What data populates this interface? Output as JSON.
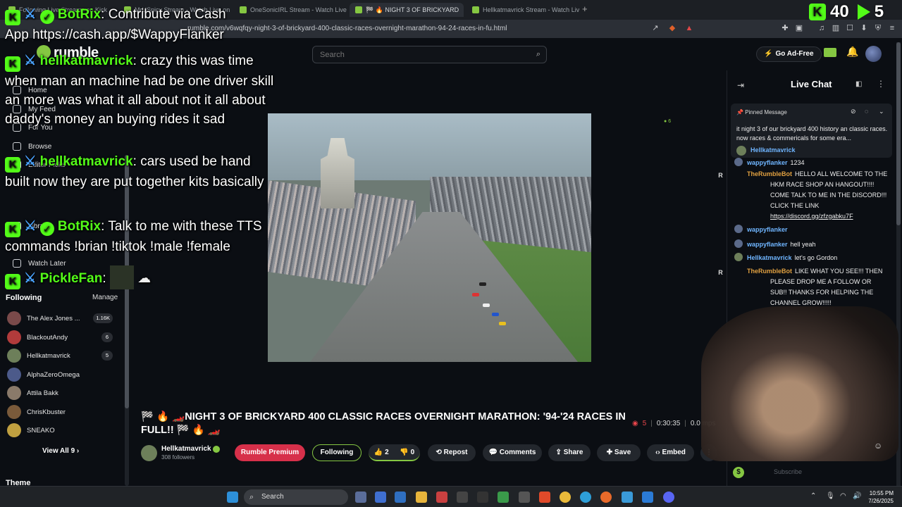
{
  "browser": {
    "tabs": [
      {
        "label": "Following Live Streams on Kick",
        "active": false
      },
      {
        "label": "MrUSpicy Stream - Watch Live on",
        "active": false
      },
      {
        "label": "OneSonicIRL Stream - Watch Live on",
        "active": false
      },
      {
        "label": "🏁 🔥 NIGHT 3 OF BRICKYARD",
        "active": true
      },
      {
        "label": "Hellkatmavrick Stream - Watch Live o",
        "active": false
      }
    ],
    "new_tab": "+",
    "url": "rumble.com/v6wqfqy-night-3-of-brickyard-400-classic-races-overnight-marathon-94-24-races-in-fu.html"
  },
  "header": {
    "logo": "rumble",
    "search_placeholder": "Search",
    "go_ad_free": "Go Ad-Free"
  },
  "sidebar": {
    "nav": [
      {
        "label": "Home"
      },
      {
        "label": "My Feed"
      },
      {
        "label": "For You"
      },
      {
        "label": "Browse"
      },
      {
        "label": "Editor Picks"
      },
      {
        "label": "Library"
      },
      {
        "label": "Watch Later"
      }
    ],
    "following_title": "Following",
    "manage": "Manage",
    "following": [
      {
        "name": "The Alex Jones ...",
        "badge": "1.16K",
        "color": "#7a4a4a"
      },
      {
        "name": "BlackoutAndy",
        "badge": "6",
        "color": "#b23b3b"
      },
      {
        "name": "Hellkatmavrick",
        "badge": "5",
        "color": "#6d7f5a"
      },
      {
        "name": "AlphaZeroOmega",
        "badge": "",
        "color": "#4c5a8a"
      },
      {
        "name": "Attila Bakk",
        "badge": "",
        "color": "#8a7a6a"
      },
      {
        "name": "ChrisKbuster",
        "badge": "",
        "color": "#7a5a3a"
      },
      {
        "name": "SNEAKO",
        "badge": "",
        "color": "#c0a040"
      }
    ],
    "view_all": "View All 9 ›",
    "theme": "Theme"
  },
  "video": {
    "title": "🏁 🔥 🏎️NIGHT 3 OF BRICKYARD 400 CLASSIC RACES OVERNIGHT MARATHON: '94-'24 RACES IN FULL!! 🏁 🔥 🏎️",
    "viewers": "5",
    "duration": "0:30:35",
    "bitrate": "0.0 mps",
    "live_count": "6"
  },
  "channel": {
    "name": "Hellkatmavrick",
    "followers": "308 followers",
    "premium_button": "Rumble Premium",
    "following_button": "Following",
    "likes": "2",
    "dislikes": "0",
    "repost": "Repost",
    "comments": "Comments",
    "share": "Share",
    "save": "Save",
    "embed": "Embed"
  },
  "chat": {
    "title": "Live Chat",
    "pinned_label": "Pinned Message",
    "pinned_text": "it night 3 of our brickyard 400 history an classic races. now races & commericals for some era...",
    "pinned_user": "Hellkatmavrick",
    "messages": [
      {
        "user": "wappyflanker",
        "text": "1234",
        "kind": "wappy"
      },
      {
        "user": "TheRumbleBot",
        "text": "HELLO ALL WELCOME TO THE HKM RACE SHOP AN HANGOUT!!!! COME TALK TO ME IN THE DISCORD!!! CLICK THE LINK ",
        "link": "https://discord.gg/zfzgabku7F",
        "kind": "bot"
      },
      {
        "user": "wappyflanker",
        "text": "",
        "kind": "wappy"
      },
      {
        "user": "wappyflanker",
        "text": "hell yeah",
        "kind": "wappy"
      },
      {
        "user": "Hellkatmavrick",
        "text": "let's go Gordon",
        "kind": "hell"
      },
      {
        "user": "TheRumbleBot",
        "text": "LIKE WHAT YOU SEE!!! THEN PLEASE DROP ME A FOLLOW OR SUB!! THANKS FOR HELPING THE CHANNEL GROW!!!!!",
        "kind": "bot"
      }
    ],
    "input_placeholder": "Subscribe"
  },
  "overlay": {
    "counter_left": "40",
    "counter_right": "5",
    "lines": [
      {
        "user": "BotRix",
        "text": "Contribute via Cash App https://cash.app/$WappyFlanker"
      },
      {
        "user": "hellkatmavrick",
        "text": "crazy this was time when man an machine had be one driver skill an more was what it all about not it all about daddy's money an buying rides it sad"
      },
      {
        "user": "hellkatmavrick",
        "text": "cars used be hand built now they are put together kits basically"
      },
      {
        "user": "BotRix",
        "text": "Talk to me with these TTS commands !brian !tiktok !male !female"
      },
      {
        "user": "PickleFan",
        "text": ""
      }
    ]
  },
  "taskbar": {
    "search": "Search",
    "time": "10:55 PM",
    "date": "7/26/2025"
  },
  "colors": {
    "rumble_green": "#85c742",
    "kick_green": "#53fc18",
    "premium_red": "#d7304a",
    "background": "#0b0e13"
  }
}
